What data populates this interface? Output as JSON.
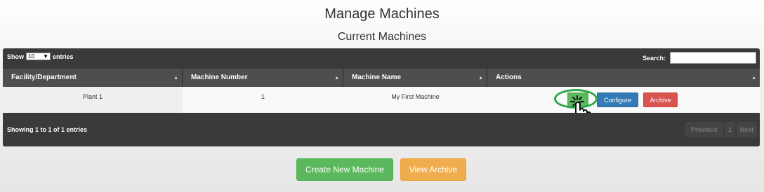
{
  "page": {
    "title": "Manage Machines",
    "section_title": "Current Machines"
  },
  "table": {
    "show_label": "Show",
    "entries_value": "10",
    "entries_label": "entries",
    "search_label": "Search:",
    "search_value": "",
    "columns": [
      "Facility/Department",
      "Machine Number",
      "Machine Name",
      "Actions"
    ],
    "rows": [
      {
        "facility": "Plant 1",
        "machine_number": "1",
        "machine_name": "My First Machine",
        "configure_label": "Configure",
        "archive_label": "Archive"
      }
    ],
    "info": "Showing 1 to 1 of 1 entries",
    "pagination": {
      "previous": "Previous",
      "current_page": "1",
      "next": "Next"
    }
  },
  "actions": {
    "create_label": "Create New Machine",
    "view_archive_label": "View Archive"
  },
  "icons": {
    "sort": "sort-caret-icon",
    "dropdown": "chevron-down-icon",
    "cursor": "hand-pointer-icon"
  },
  "colors": {
    "success": "#5cb85c",
    "primary": "#337ab7",
    "danger": "#d9534f",
    "warning": "#f0ad4e",
    "table_dark": "#3a3a3a",
    "highlight": "#2aa84a"
  }
}
